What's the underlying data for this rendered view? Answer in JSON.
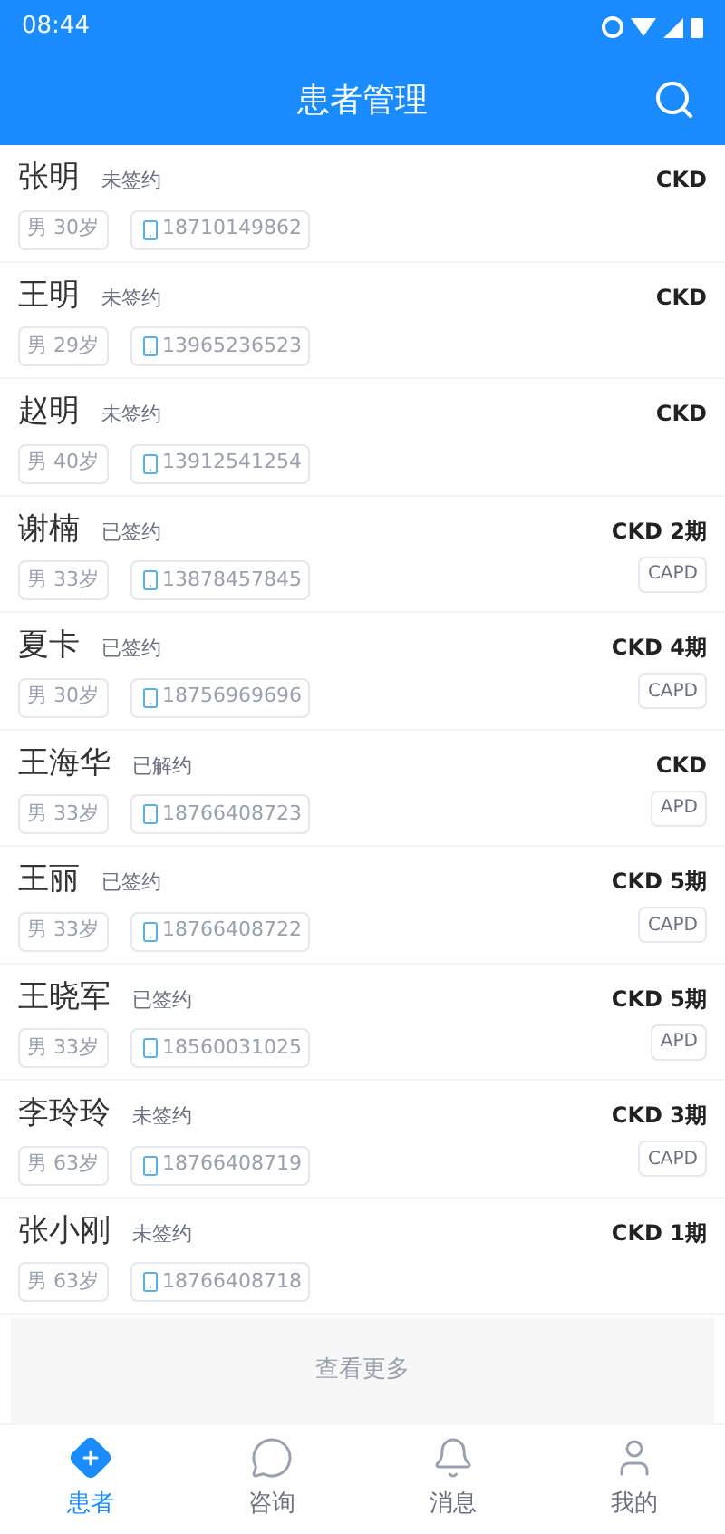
{
  "status_bar": {
    "time": "08:44"
  },
  "header": {
    "title": "患者管理"
  },
  "patients": [
    {
      "name": "张明",
      "status": "未签约",
      "diagnosis": "CKD",
      "gender": "男",
      "age": "30岁",
      "phone": "18710149862"
    },
    {
      "name": "王明",
      "status": "未签约",
      "diagnosis": "CKD",
      "gender": "男",
      "age": "29岁",
      "phone": "13965236523"
    },
    {
      "name": "赵明",
      "status": "未签约",
      "diagnosis": "CKD",
      "gender": "男",
      "age": "40岁",
      "phone": "13912541254"
    },
    {
      "name": "谢楠",
      "status": "已签约",
      "diagnosis": "CKD 2期",
      "gender": "男",
      "age": "33岁",
      "phone": "13878457845",
      "tag": "CAPD"
    },
    {
      "name": "夏卡",
      "status": "已签约",
      "diagnosis": "CKD 4期",
      "gender": "男",
      "age": "30岁",
      "phone": "18756969696",
      "tag": "CAPD"
    },
    {
      "name": "王海华",
      "status": "已解约",
      "diagnosis": "CKD",
      "gender": "男",
      "age": "33岁",
      "phone": "18766408723",
      "tag": "APD"
    },
    {
      "name": "王丽",
      "status": "已签约",
      "diagnosis": "CKD 5期",
      "gender": "男",
      "age": "33岁",
      "phone": "18766408722",
      "tag": "CAPD"
    },
    {
      "name": "王晓军",
      "status": "已签约",
      "diagnosis": "CKD 5期",
      "gender": "男",
      "age": "33岁",
      "phone": "18560031025",
      "tag": "APD"
    },
    {
      "name": "李玲玲",
      "status": "未签约",
      "diagnosis": "CKD 3期",
      "gender": "男",
      "age": "63岁",
      "phone": "18766408719",
      "tag": "CAPD"
    },
    {
      "name": "张小刚",
      "status": "未签约",
      "diagnosis": "CKD 1期",
      "gender": "男",
      "age": "63岁",
      "phone": "18766408718"
    }
  ],
  "more_button": "查看更多",
  "tab_bar": [
    {
      "label": "患者",
      "selected": true,
      "kind": "patients"
    },
    {
      "label": "咨询",
      "selected": false,
      "kind": "consult"
    },
    {
      "label": "消息",
      "selected": false,
      "kind": "messages"
    },
    {
      "label": "我的",
      "selected": false,
      "kind": "profile"
    }
  ]
}
